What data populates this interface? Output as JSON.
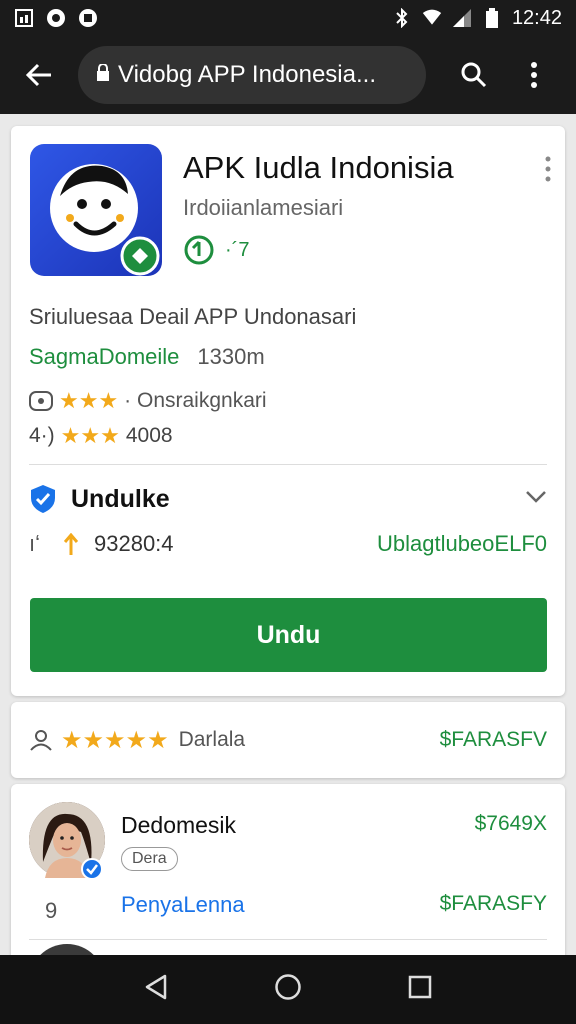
{
  "status_bar": {
    "time": "12:42"
  },
  "app_bar": {
    "url": "Vidobg APP Indonesia..."
  },
  "app": {
    "title": "APK Iudla Indonisia",
    "subtitle": "Irdoiianlamesiari",
    "badge_text": "·´7"
  },
  "details": {
    "description": "Sriuluesaa Deail APP Undonasari",
    "category": "SagmaDomeile",
    "size": "1330m",
    "rating_line_label": "· Onsraikgnkari",
    "rating_count_prefix": "4·)",
    "rating_count": "4008"
  },
  "download_section": {
    "label": "Undulke",
    "version_prefix": "ıʻ",
    "version": "93280:4",
    "link": "UblagtlubeoELF0",
    "button_label": "Undu"
  },
  "rating_card": {
    "label": "Darlala",
    "right_text": "$FARASFV"
  },
  "developer": {
    "name": "Dedomesik",
    "price": "$7649X",
    "chip": "Dera",
    "number": "9",
    "link": "PenyaLenna",
    "right_text": "$FARASFY"
  },
  "colors": {
    "accent_green": "#1e8e3e",
    "bar": "#1b1b1b",
    "link_blue": "#1a73e8",
    "star": "#f2a91b"
  }
}
